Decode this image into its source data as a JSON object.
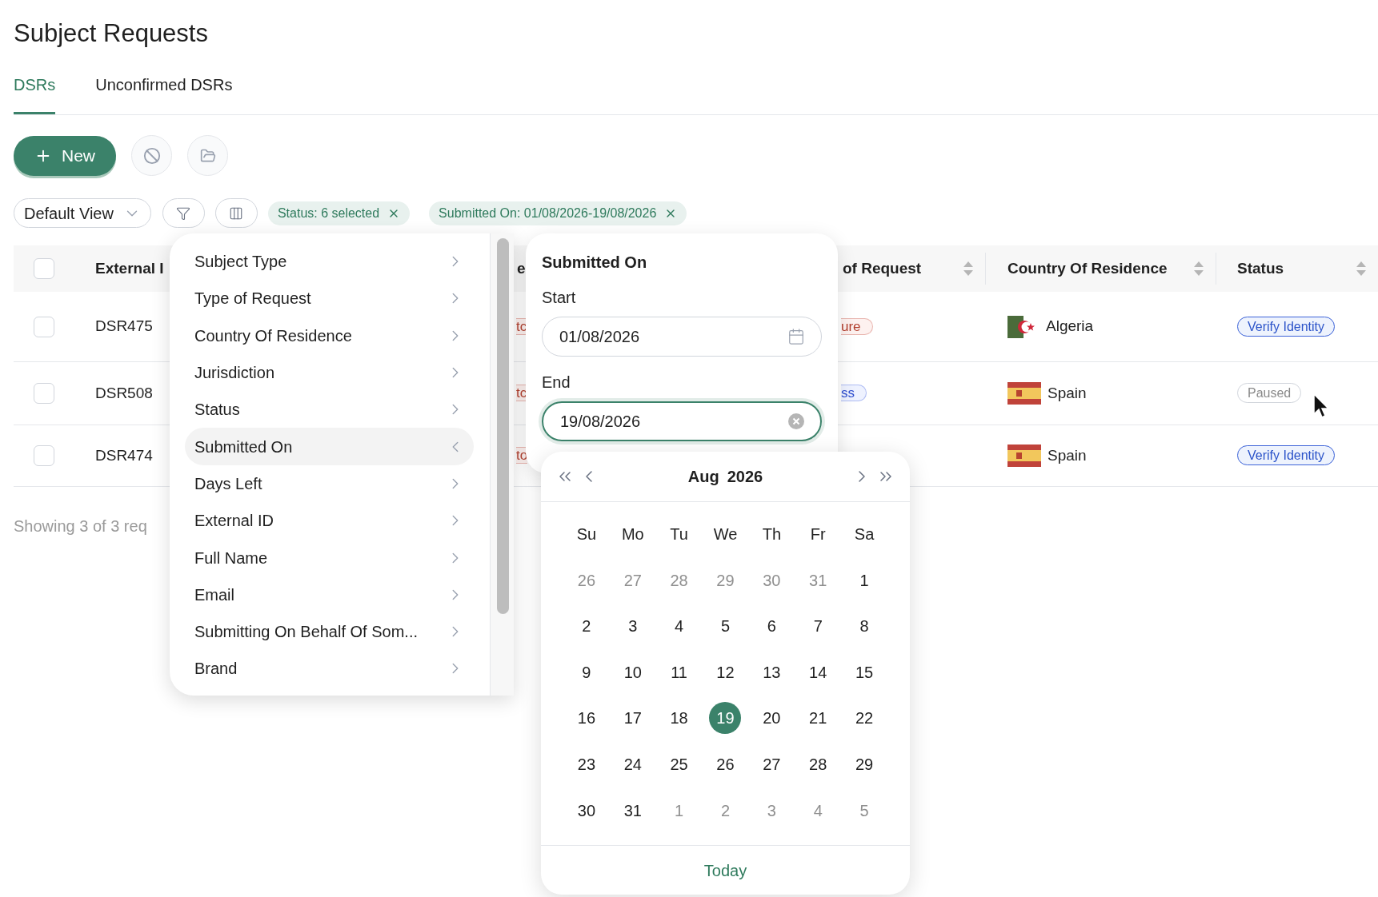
{
  "page": {
    "title": "Subject Requests"
  },
  "tabs": [
    {
      "label": "DSRs",
      "selected": true
    },
    {
      "label": "Unconfirmed DSRs",
      "selected": false
    }
  ],
  "toolbar": {
    "new_button": "New",
    "view_select": "Default View"
  },
  "filter_chips": [
    {
      "label": "Status: 6 selected"
    },
    {
      "label": "Submitted On: 01/08/2026-19/08/2026"
    }
  ],
  "table": {
    "select_all_checked": false,
    "columns": [
      {
        "label": "External I",
        "sortable": false
      },
      {
        "label": "e",
        "sortable": false
      },
      {
        "label": "of Request",
        "sortable": true
      },
      {
        "label": "Country Of Residence",
        "sortable": true
      },
      {
        "label": "Status",
        "sortable": true
      }
    ],
    "rows": [
      {
        "kind": "algeria",
        "checked": false,
        "external_id": "DSR475",
        "column_2": {
          "text": "tc",
          "kind": "red"
        },
        "type_of_request": {
          "text": "ure",
          "kind": "red"
        },
        "country": "Algeria",
        "status": {
          "text": "Verify Identity",
          "kind": "blue"
        }
      },
      {
        "kind": "spain",
        "checked": false,
        "external_id": "DSR508",
        "column_2": {
          "text": "tc",
          "kind": "red"
        },
        "type_of_request": {
          "text": "ss",
          "kind": "blue"
        },
        "country": "Spain",
        "status": {
          "text": "Paused",
          "kind": "gray"
        }
      },
      {
        "kind": "spain",
        "checked": false,
        "external_id": "DSR474",
        "column_2": {
          "text": "to",
          "kind": "red"
        },
        "country": "Spain",
        "status": {
          "text": "Verify Identity",
          "kind": "blue"
        }
      }
    ],
    "footer": "Showing 3 of 3 req"
  },
  "filter_menu": {
    "items": [
      {
        "label": "Subject Type",
        "selected": false
      },
      {
        "label": "Type of Request",
        "selected": false
      },
      {
        "label": "Country Of Residence",
        "selected": false
      },
      {
        "label": "Jurisdiction",
        "selected": false
      },
      {
        "label": "Status",
        "selected": false
      },
      {
        "label": "Submitted On",
        "selected": true
      },
      {
        "label": "Days Left",
        "selected": false
      },
      {
        "label": "External ID",
        "selected": false
      },
      {
        "label": "Full Name",
        "selected": false
      },
      {
        "label": "Email",
        "selected": false
      },
      {
        "label": "Submitting On Behalf Of Som...",
        "selected": false
      },
      {
        "label": "Brand",
        "selected": false
      }
    ]
  },
  "date_filter": {
    "title": "Submitted On",
    "fields": [
      {
        "label": "Start",
        "value": "01/08/2026",
        "focused": false
      },
      {
        "label": "End",
        "value": "19/08/2026",
        "focused": true
      }
    ]
  },
  "calendar": {
    "month": "Aug",
    "year": "2026",
    "weekdays": [
      "Su",
      "Mo",
      "Tu",
      "We",
      "Th",
      "Fr",
      "Sa"
    ],
    "weeks": [
      [
        {
          "day": "26",
          "outside": true,
          "selected": false
        },
        {
          "day": "27",
          "outside": true,
          "selected": false
        },
        {
          "day": "28",
          "outside": true,
          "selected": false
        },
        {
          "day": "29",
          "outside": true,
          "selected": false
        },
        {
          "day": "30",
          "outside": true,
          "selected": false
        },
        {
          "day": "31",
          "outside": true,
          "selected": false
        },
        {
          "day": "1",
          "outside": false,
          "selected": false
        }
      ],
      [
        {
          "day": "2",
          "outside": false,
          "selected": false
        },
        {
          "day": "3",
          "outside": false,
          "selected": false
        },
        {
          "day": "4",
          "outside": false,
          "selected": false
        },
        {
          "day": "5",
          "outside": false,
          "selected": false
        },
        {
          "day": "6",
          "outside": false,
          "selected": false
        },
        {
          "day": "7",
          "outside": false,
          "selected": false
        },
        {
          "day": "8",
          "outside": false,
          "selected": false
        }
      ],
      [
        {
          "day": "9",
          "outside": false,
          "selected": false
        },
        {
          "day": "10",
          "outside": false,
          "selected": false
        },
        {
          "day": "11",
          "outside": false,
          "selected": false
        },
        {
          "day": "12",
          "outside": false,
          "selected": false
        },
        {
          "day": "13",
          "outside": false,
          "selected": false
        },
        {
          "day": "14",
          "outside": false,
          "selected": false
        },
        {
          "day": "15",
          "outside": false,
          "selected": false
        }
      ],
      [
        {
          "day": "16",
          "outside": false,
          "selected": false
        },
        {
          "day": "17",
          "outside": false,
          "selected": false
        },
        {
          "day": "18",
          "outside": false,
          "selected": false
        },
        {
          "day": "19",
          "outside": false,
          "selected": true
        },
        {
          "day": "20",
          "outside": false,
          "selected": false
        },
        {
          "day": "21",
          "outside": false,
          "selected": false
        },
        {
          "day": "22",
          "outside": false,
          "selected": false
        }
      ],
      [
        {
          "day": "23",
          "outside": false,
          "selected": false
        },
        {
          "day": "24",
          "outside": false,
          "selected": false
        },
        {
          "day": "25",
          "outside": false,
          "selected": false
        },
        {
          "day": "26",
          "outside": false,
          "selected": false
        },
        {
          "day": "27",
          "outside": false,
          "selected": false
        },
        {
          "day": "28",
          "outside": false,
          "selected": false
        },
        {
          "day": "29",
          "outside": false,
          "selected": false
        }
      ],
      [
        {
          "day": "30",
          "outside": false,
          "selected": false
        },
        {
          "day": "31",
          "outside": false,
          "selected": false
        },
        {
          "day": "1",
          "outside": true,
          "selected": false
        },
        {
          "day": "2",
          "outside": true,
          "selected": false
        },
        {
          "day": "3",
          "outside": true,
          "selected": false
        },
        {
          "day": "4",
          "outside": true,
          "selected": false
        },
        {
          "day": "5",
          "outside": true,
          "selected": false
        }
      ]
    ],
    "today_button": "Today"
  }
}
